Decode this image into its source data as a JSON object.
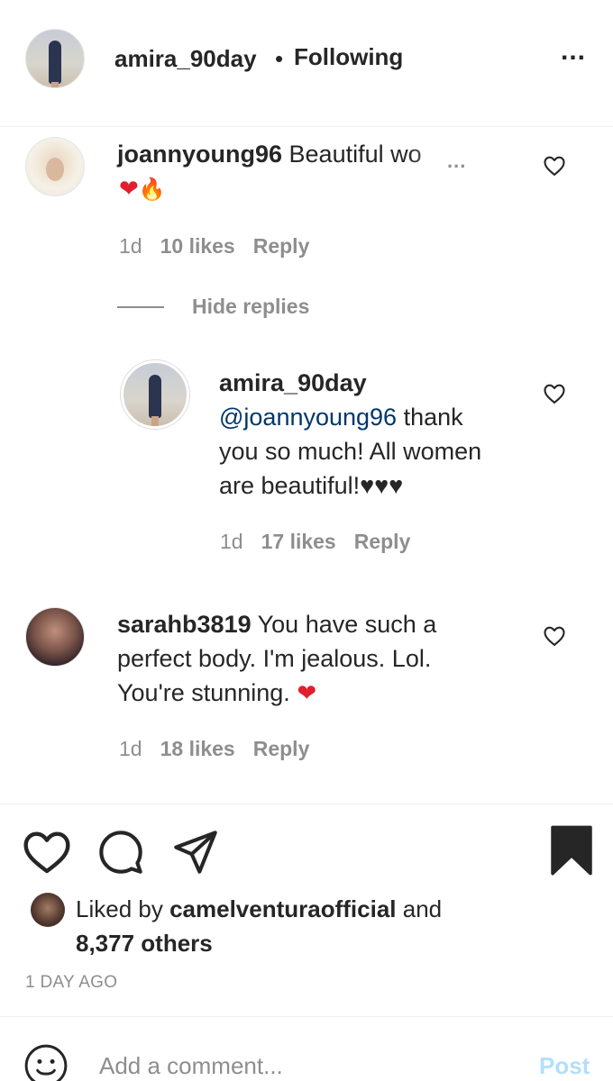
{
  "post": {
    "username": "amira_90day",
    "separator": "•",
    "follow_status": "Following",
    "more_label": "..."
  },
  "comments": [
    {
      "username": "joannyoung96",
      "text": "Beautiful wo",
      "emoji": [
        "❤",
        "🔥"
      ],
      "time": "1d",
      "likes": "10 likes",
      "reply": "Reply",
      "hide_replies": "Hide replies",
      "more_label": "..."
    },
    {
      "username": "amira_90day",
      "mention": "@joannyoung96",
      "text_line1": "thank",
      "text_line2": "you so much! All women",
      "text_line3": "are beautiful!♥♥♥",
      "time": "1d",
      "likes": "17 likes",
      "reply": "Reply"
    },
    {
      "username": "sarahb3819",
      "text_line1": "You have such a",
      "text_line2": "perfect body. I'm jealous. Lol.",
      "text_line3": "You're stunning.",
      "emoji": "❤",
      "time": "1d",
      "likes": "18 likes",
      "reply": "Reply"
    }
  ],
  "liked_by": {
    "prefix": "Liked by",
    "user": "camelventuraofficial",
    "mid": "and",
    "others": "8,377 others"
  },
  "time_ago": "1 DAY AGO",
  "add_comment": {
    "placeholder": "Add a comment...",
    "post_label": "Post"
  },
  "icons": {
    "like": "heart-icon",
    "comment": "comment-icon",
    "share": "share-icon",
    "save": "bookmark-icon",
    "emoji": "smiley-icon"
  }
}
